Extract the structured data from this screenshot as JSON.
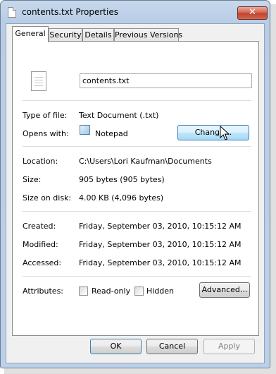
{
  "window": {
    "title": "contents.txt Properties",
    "close_glyph": "✕"
  },
  "tabs": [
    {
      "label": "General",
      "active": true
    },
    {
      "label": "Security"
    },
    {
      "label": "Details"
    },
    {
      "label": "Previous Versions"
    }
  ],
  "general": {
    "file_name": "contents.txt",
    "type_label": "Type of file:",
    "type_value": "Text Document (.txt)",
    "opens_label": "Opens with:",
    "opens_value": "Notepad",
    "change_button": "Change...",
    "location_label": "Location:",
    "location_value": "C:\\Users\\Lori Kaufman\\Documents",
    "size_label": "Size:",
    "size_value": "905 bytes (905 bytes)",
    "size_disk_label": "Size on disk:",
    "size_disk_value": "4.00 KB (4,096 bytes)",
    "created_label": "Created:",
    "created_value": "Friday, September 03, 2010, 10:15:12 AM",
    "modified_label": "Modified:",
    "modified_value": "Friday, September 03, 2010, 10:15:12 AM",
    "accessed_label": "Accessed:",
    "accessed_value": "Friday, September 03, 2010, 10:15:12 AM",
    "attributes_label": "Attributes:",
    "readonly_label": "Read-only",
    "readonly_checked": false,
    "hidden_label": "Hidden",
    "hidden_checked": false,
    "advanced_button": "Advanced..."
  },
  "footer": {
    "ok": "OK",
    "cancel": "Cancel",
    "apply": "Apply"
  },
  "icons": [
    "file-icon",
    "notepad-icon",
    "close-icon",
    "mouse-cursor-icon"
  ],
  "colors": {
    "titlebar": "#bcd0e8",
    "close": "#c7442e",
    "hover_button": "#bee6fd"
  }
}
